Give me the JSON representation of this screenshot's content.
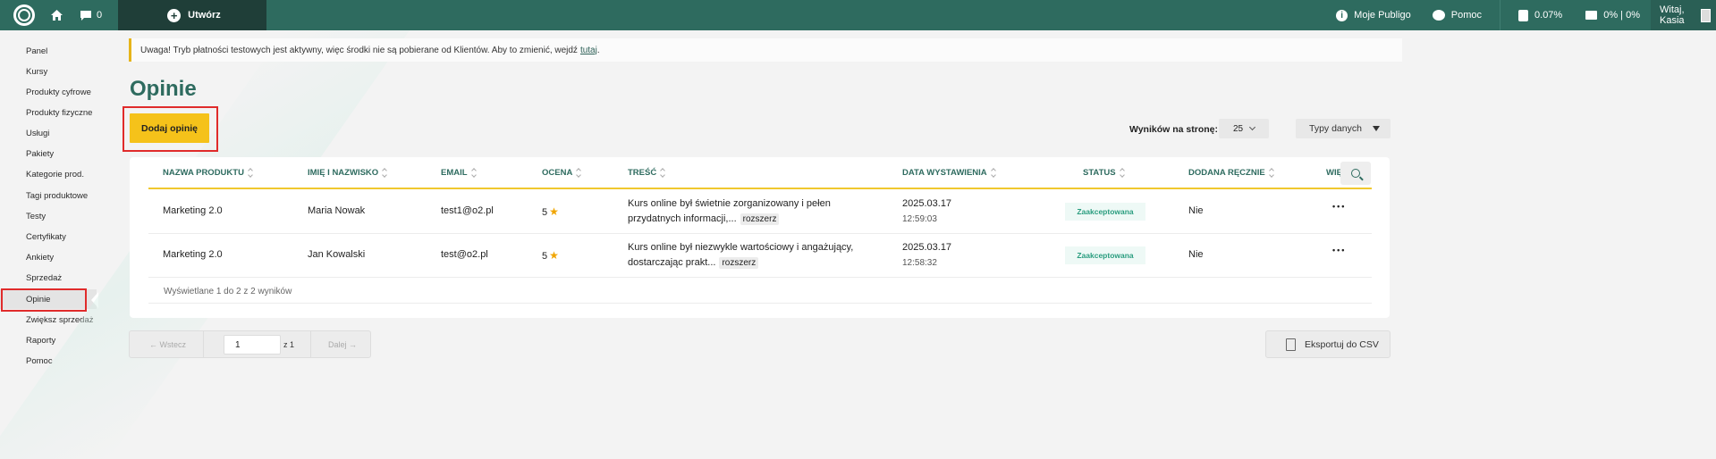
{
  "topbar": {
    "comments_count": "0",
    "create_label": "Utwórz",
    "my_publigo": "Moje Publigo",
    "help": "Pomoc",
    "storage": "0.07%",
    "mail": "0% | 0%",
    "greeting": "Witaj, Kasia"
  },
  "sidebar": {
    "items": [
      {
        "label": "Panel",
        "icon": "lightbulb-icon"
      },
      {
        "label": "Kursy",
        "icon": "graduation-cap-icon"
      },
      {
        "label": "Produkty cyfrowe",
        "icon": "download-icon"
      },
      {
        "label": "Produkty fizyczne",
        "icon": "package-icon"
      },
      {
        "label": "Usługi",
        "icon": "user-icon"
      },
      {
        "label": "Pakiety",
        "icon": "grid-icon"
      },
      {
        "label": "Kategorie prod.",
        "icon": "folder-icon"
      },
      {
        "label": "Tagi produktowe",
        "icon": "tag-icon"
      },
      {
        "label": "Testy",
        "icon": "pencil-square-icon"
      },
      {
        "label": "Certyfikaty",
        "icon": "certificate-icon"
      },
      {
        "label": "Ankiety",
        "icon": "clipboard-icon"
      },
      {
        "label": "Sprzedaż",
        "icon": "cart-icon"
      },
      {
        "label": "Opinie",
        "icon": "document-icon"
      },
      {
        "label": "Zwiększ sprzedaż",
        "icon": "bar-chart-icon"
      },
      {
        "label": "Raporty",
        "icon": "line-chart-icon"
      },
      {
        "label": "Pomoc",
        "icon": "help-icon"
      }
    ]
  },
  "notice": {
    "text": "Uwaga! Tryb płatności testowych jest aktywny, więc środki nie są pobierane od Klientów. Aby to zmienić, wejdź",
    "link": "tutaj",
    "end": "."
  },
  "page": {
    "title": "Opinie",
    "add_button": "Dodaj opinię",
    "per_page_label": "Wyników na stronę:",
    "per_page_value": "25",
    "data_types": "Typy danych"
  },
  "table": {
    "columns": [
      "NAZWA PRODUKTU",
      "IMIĘ I NAZWISKO",
      "EMAIL",
      "OCENA",
      "TREŚĆ",
      "DATA WYSTAWIENIA",
      "STATUS",
      "DODANA RĘCZNIE",
      "WIĘ"
    ],
    "rows": [
      {
        "product": "Marketing 2.0",
        "name": "Maria Nowak",
        "email": "test1@o2.pl",
        "rating": "5",
        "content_line1": "Kurs online był świetnie zorganizowany i pełen",
        "content_line2": "przydatnych informacji,...",
        "expand": "rozszerz",
        "date": "2025.03.17",
        "time": "12:59:03",
        "status": "Zaakceptowana",
        "manual": "Nie"
      },
      {
        "product": "Marketing 2.0",
        "name": "Jan Kowalski",
        "email": "test@o2.pl",
        "rating": "5",
        "content_line1": "Kurs online był niezwykle wartościowy i angażujący,",
        "content_line2": "dostarczając prakt...",
        "expand": "rozszerz",
        "date": "2025.03.17",
        "time": "12:58:32",
        "status": "Zaakceptowana",
        "manual": "Nie"
      }
    ],
    "footer": "Wyświetlane 1 do 2 z 2 wyników"
  },
  "pagination": {
    "prev": "Wstecz",
    "page": "1",
    "of": "z 1",
    "next": "Dalej"
  },
  "export": "Eksportuj do CSV",
  "colors": {
    "brand": "#2e6b5f",
    "accent": "#f5c21a",
    "highlight": "#e02b2b"
  }
}
